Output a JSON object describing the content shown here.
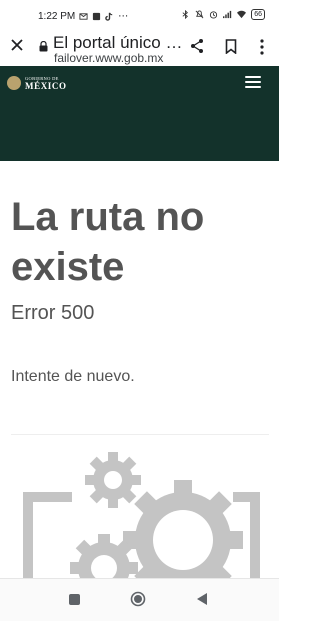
{
  "status_bar": {
    "time": "1:22 PM",
    "battery": "66",
    "icons": [
      "mail-icon",
      "dialpad-icon",
      "tiktok-icon",
      "more-dots-icon",
      "bluetooth-icon",
      "mute-icon",
      "alarm-icon",
      "signal-icon",
      "wifi-icon",
      "battery-icon"
    ]
  },
  "url_bar": {
    "title": "El portal único …",
    "host": "failover.www.gob.mx"
  },
  "header": {
    "brand_small": "GOBIERNO DE",
    "brand_big": "MÉXICO",
    "colors": {
      "background": "#13322b",
      "seal": "#b9a26e"
    }
  },
  "content": {
    "title": "La ruta no existe",
    "error": "Error 500",
    "message": "Intente de nuevo."
  },
  "nav": {
    "icons": [
      "recents-square-icon",
      "home-circle-icon",
      "back-triangle-icon"
    ]
  }
}
